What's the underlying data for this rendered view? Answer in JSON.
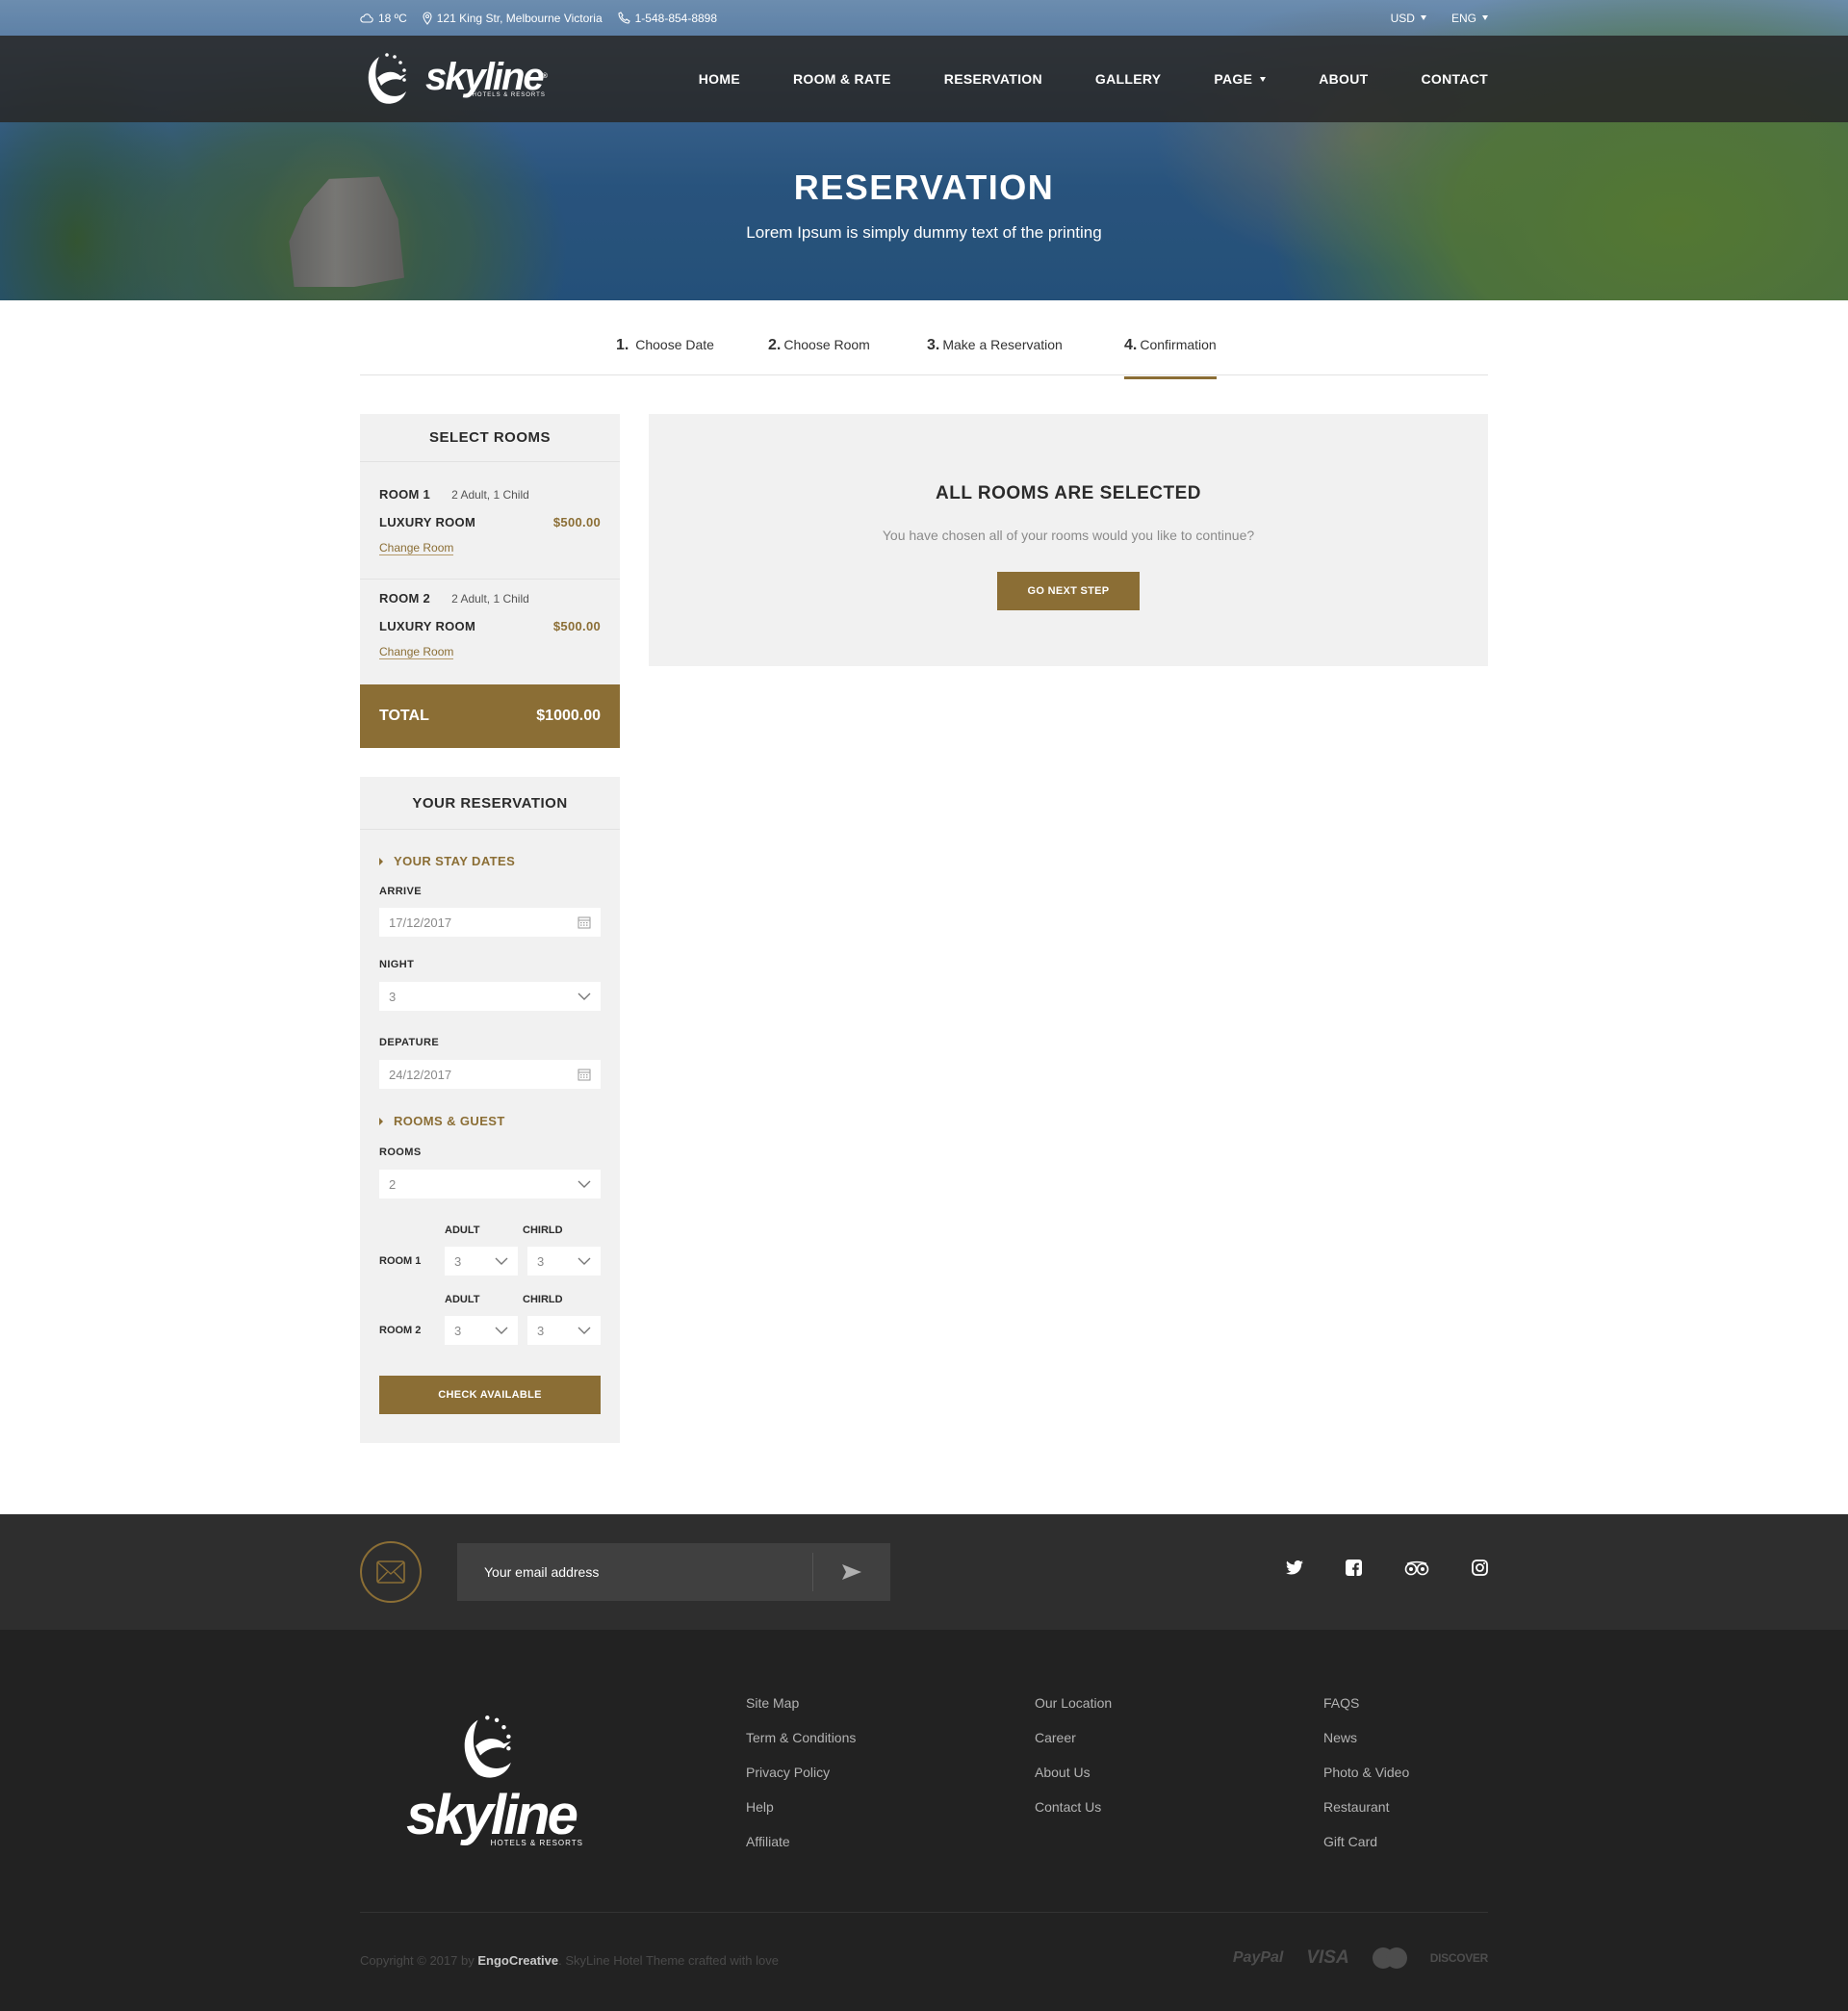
{
  "topbar": {
    "weather": "18 ºC",
    "address": "121 King Str, Melbourne Victoria",
    "phone": "1-548-854-8898",
    "currency": "USD",
    "language": "ENG"
  },
  "brand": {
    "name": "skyline",
    "tagline": "HOTELS & RESORTS",
    "registered": "®"
  },
  "nav": {
    "items": [
      {
        "label": "HOME"
      },
      {
        "label": "ROOM & RATE"
      },
      {
        "label": "RESERVATION"
      },
      {
        "label": "GALLERY"
      },
      {
        "label": "PAGE",
        "has_dropdown": true
      },
      {
        "label": "ABOUT"
      },
      {
        "label": "CONTACT"
      }
    ]
  },
  "hero": {
    "title": "RESERVATION",
    "subtitle": "Lorem Ipsum is simply dummy text of the printing"
  },
  "steps": [
    {
      "num": "1.",
      "label": "Choose Date",
      "active": false
    },
    {
      "num": "2.",
      "label": "Choose Room",
      "active": false
    },
    {
      "num": "3.",
      "label": "Make a Reservation",
      "active": false
    },
    {
      "num": "4.",
      "label": "Confirmation",
      "active": true
    }
  ],
  "select_rooms": {
    "title": "SELECT ROOMS",
    "rooms": [
      {
        "label": "ROOM 1",
        "guests": "2 Adult, 1 Child",
        "type": "LUXURY ROOM",
        "price": "$500.00",
        "change_label": "Change Room"
      },
      {
        "label": "ROOM 2",
        "guests": "2 Adult, 1 Child",
        "type": "LUXURY ROOM",
        "price": "$500.00",
        "change_label": "Change Room"
      }
    ],
    "total_label": "TOTAL",
    "total_value": "$1000.00"
  },
  "confirmation": {
    "title": "ALL ROOMS ARE SELECTED",
    "message": "You have chosen all of your rooms would you like to continue?",
    "button_label": "GO NEXT STEP"
  },
  "reservation": {
    "title": "YOUR RESERVATION",
    "stay_dates_title": "YOUR STAY DATES",
    "arrive_label": "ARRIVE",
    "arrive_value": "17/12/2017",
    "night_label": "NIGHT",
    "night_value": "3",
    "departure_label": "DEPATURE",
    "departure_value": "24/12/2017",
    "rooms_guest_title": "ROOMS & GUEST",
    "rooms_label": "ROOMS",
    "rooms_value": "2",
    "adult_label": "ADULT",
    "child_label": "CHIRLD",
    "room_rows": [
      {
        "label": "ROOM 1",
        "adult": "3",
        "child": "3"
      },
      {
        "label": "ROOM 2",
        "adult": "3",
        "child": "3"
      }
    ],
    "button_label": "CHECK AVAILABLE"
  },
  "newsletter": {
    "placeholder": "Your email address"
  },
  "social": [
    "twitter",
    "facebook",
    "tripadvisor",
    "instagram"
  ],
  "footer": {
    "col1": [
      "Site Map",
      "Term & Conditions",
      "Privacy Policy",
      "Help",
      "Affiliate"
    ],
    "col2": [
      "Our Location",
      "Career",
      "About Us",
      "Contact Us"
    ],
    "col3": [
      "FAQS",
      "News",
      "Photo & Video",
      "Restaurant",
      "Gift Card"
    ],
    "copyright_prefix": "Copyright © 2017 by ",
    "copyright_brand": "EngoCreative",
    "copyright_suffix": ". SkyLine Hotel Theme crafted with love",
    "payments": {
      "paypal": "PayPal",
      "visa": "VISA",
      "mastercard": "MasterCard",
      "discover": "DISCOVER"
    }
  },
  "colors": {
    "accent": "#8b6e35",
    "panel": "#f1f1f1",
    "footer_top": "#2e2e2e",
    "footer_bottom": "#222222"
  }
}
